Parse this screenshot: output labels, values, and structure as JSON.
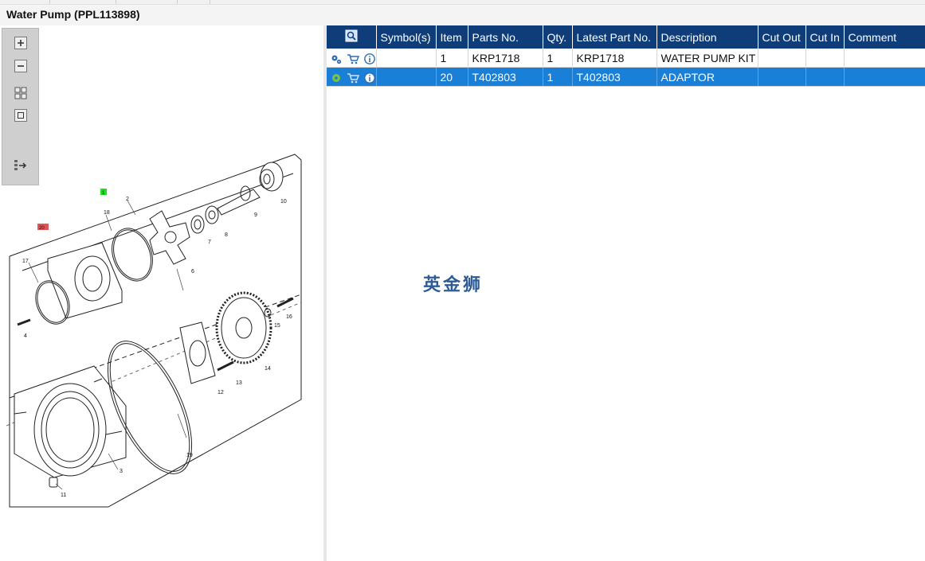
{
  "window": {
    "title": "Water Pump (PPL113898)"
  },
  "toolbar": {
    "buttons": [
      "zoom-in",
      "zoom-out",
      "fit-all",
      "fit-window",
      "export"
    ]
  },
  "diagram": {
    "callouts": [
      "2",
      "3",
      "4",
      "6",
      "7",
      "8",
      "9",
      "10",
      "11",
      "12",
      "13",
      "14",
      "15",
      "16",
      "17",
      "18",
      "19"
    ],
    "highlight_green": "1",
    "highlight_red": "20"
  },
  "grid": {
    "columns": [
      "Symbol(s)",
      "Item",
      "Parts No.",
      "Qty.",
      "Latest Part No.",
      "Description",
      "Cut Out",
      "Cut In",
      "Comment"
    ],
    "rows": [
      {
        "symbols": "",
        "item": "1",
        "parts_no": "KRP1718",
        "qty": "1",
        "latest": "KRP1718",
        "description": "WATER PUMP KIT",
        "cut_out": "",
        "cut_in": "",
        "comment": ""
      },
      {
        "symbols": "",
        "item": "20",
        "parts_no": "T402803",
        "qty": "1",
        "latest": "T402803",
        "description": "ADAPTOR",
        "cut_out": "",
        "cut_in": "",
        "comment": ""
      }
    ],
    "selected_row": 2
  },
  "watermark": "英金狮",
  "colors": {
    "header_bg": "#0f3d7a",
    "selected_bg": "#1a7fd6"
  }
}
